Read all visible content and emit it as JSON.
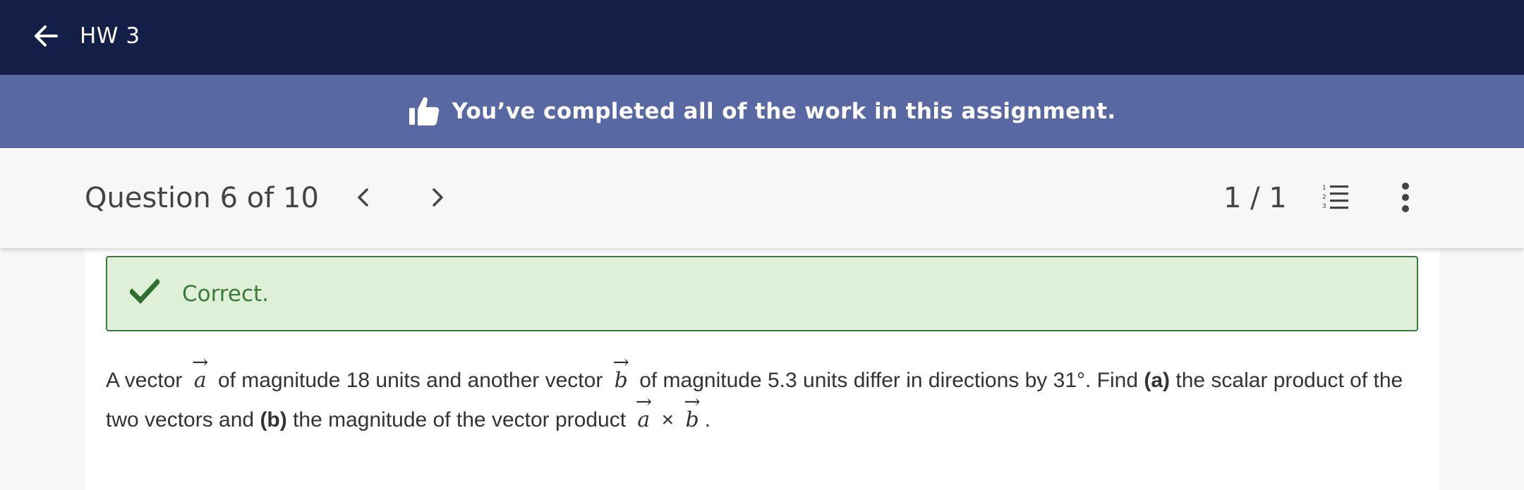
{
  "header": {
    "title": "HW 3"
  },
  "banner": {
    "message": "You’ve completed all of the work in this assignment."
  },
  "question_nav": {
    "label": "Question 6 of 10",
    "score": "1 / 1"
  },
  "feedback": {
    "status": "Correct."
  },
  "question": {
    "part1": "A vector ",
    "vec_a": "a",
    "part2": " of magnitude 18 units and another vector ",
    "vec_b": "b",
    "part3": " of magnitude 5.3 units differ in directions by 31°. Find ",
    "label_a": "(a)",
    "part4": " the scalar product of the two vectors and ",
    "label_b": "(b)",
    "part5": " the magnitude of the vector product ",
    "vec_a2": "a",
    "cross": " × ",
    "vec_b2": "b",
    "part6": "."
  },
  "colors": {
    "topbar": "#141f48",
    "banner": "#5768a2",
    "feedback_bg": "#dff0d8",
    "feedback_border": "#3c7a3c",
    "feedback_text": "#3a7a38"
  },
  "icons": {
    "back": "arrow-left-icon",
    "banner": "thumbs-up-icon",
    "prev": "chevron-left-icon",
    "next": "chevron-right-icon",
    "list": "numbered-list-icon",
    "more": "more-vertical-icon",
    "status": "checkmark-icon"
  }
}
